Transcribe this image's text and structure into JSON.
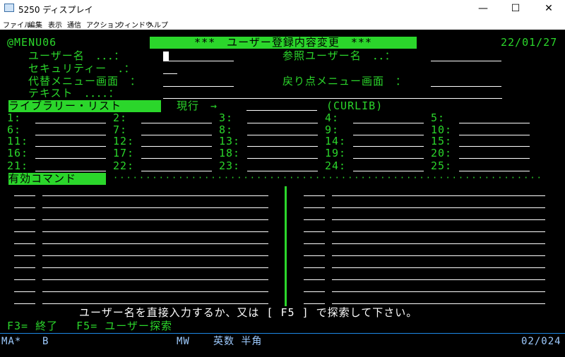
{
  "window": {
    "title": "5250 ディスプレイ",
    "minimize": "—",
    "maximize": "☐",
    "close": "✕"
  },
  "menu": [
    "ファイル",
    "編集",
    "表示",
    "通信",
    "アクション",
    "ウィンドウ",
    "ヘルプ"
  ],
  "screen": {
    "menu_id": "@MENU06",
    "title": "***　ユーザー登録内容変更　***",
    "date": "22/01/27",
    "labels": {
      "user_name": "ユーザー名　．．．：",
      "security": "セキュリティー　．：",
      "alt_menu": "代替メニュー画面　：",
      "text": "テキスト　．．．．：",
      "ref_user": "参照ユーザー名　．．：",
      "return_menu": "戻り点メニュー画面　："
    },
    "library_header": "ライブラリー・リスト",
    "current_label": "現行　→",
    "curlib": "(CURLIB)",
    "library_numbers": [
      "1:",
      "2:",
      "3:",
      "4:",
      "5:",
      "6:",
      "7:",
      "8:",
      "9:",
      "10:",
      "11:",
      "12:",
      "13:",
      "14:",
      "15:",
      "16:",
      "17:",
      "18:",
      "19:",
      "20:",
      "21:",
      "22:",
      "23:",
      "24:",
      "25:"
    ],
    "commands_header": "有効コマンド",
    "message": "ユーザー名を直接入力するか、又は [ F5 ] で探索して下さい。",
    "fkeys": "F3= 終了　 F5= ユーザー探索"
  },
  "status_bar": {
    "ma": "MA*",
    "b": "B",
    "mw": "MW",
    "mode": "英数 半角",
    "position": "02/024"
  }
}
